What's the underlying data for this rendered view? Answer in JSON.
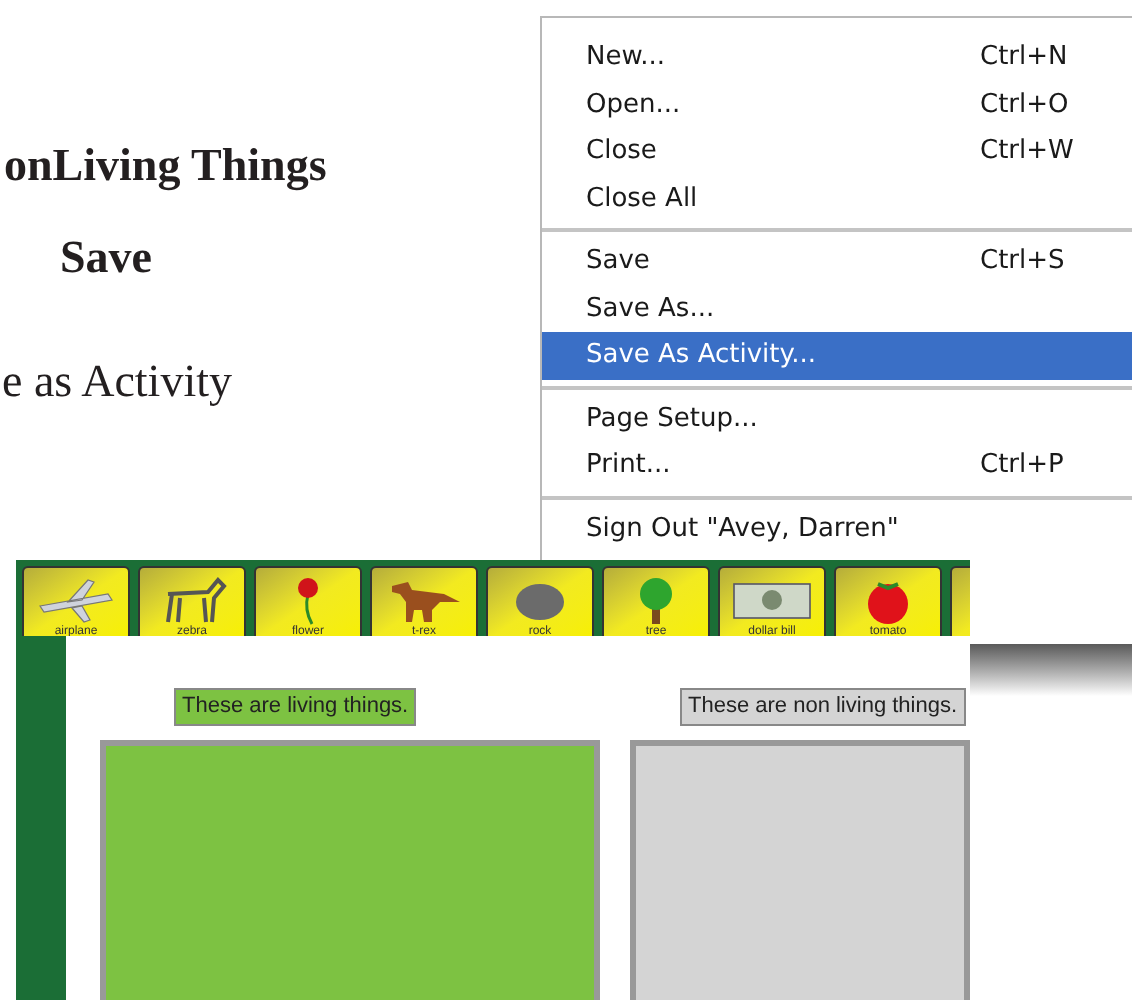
{
  "headings": [
    "onLiving Things",
    "Save"
  ],
  "body_text": "e as Activity",
  "file_menu": {
    "groups": [
      [
        {
          "label": "New...",
          "shortcut": "Ctrl+N",
          "selected": false
        },
        {
          "label": "Open...",
          "shortcut": "Ctrl+O",
          "selected": false
        },
        {
          "label": "Close",
          "shortcut": "Ctrl+W",
          "selected": false
        },
        {
          "label": "Close All",
          "selected": false
        }
      ],
      [
        {
          "label": "Save",
          "shortcut": "Ctrl+S",
          "selected": false
        },
        {
          "label": "Save As...",
          "selected": false
        },
        {
          "label": "Save As Activity...",
          "selected": true
        }
      ],
      [
        {
          "label": "Page Setup...",
          "selected": false
        },
        {
          "label": "Print...",
          "shortcut": "Ctrl+P",
          "selected": false
        }
      ],
      [
        {
          "label": "Sign Out \"Avey, Darren\"",
          "selected": false
        }
      ]
    ]
  },
  "activity": {
    "tiles": [
      {
        "label": "airplane"
      },
      {
        "label": "zebra"
      },
      {
        "label": "flower"
      },
      {
        "label": "t-rex"
      },
      {
        "label": "rock"
      },
      {
        "label": "tree"
      },
      {
        "label": "dollar bill"
      },
      {
        "label": "tomato"
      }
    ],
    "categories": [
      {
        "label": "These are living things.",
        "color": "#7dc242"
      },
      {
        "label": "These are non living things.",
        "color": "#d4d4d4"
      }
    ]
  }
}
